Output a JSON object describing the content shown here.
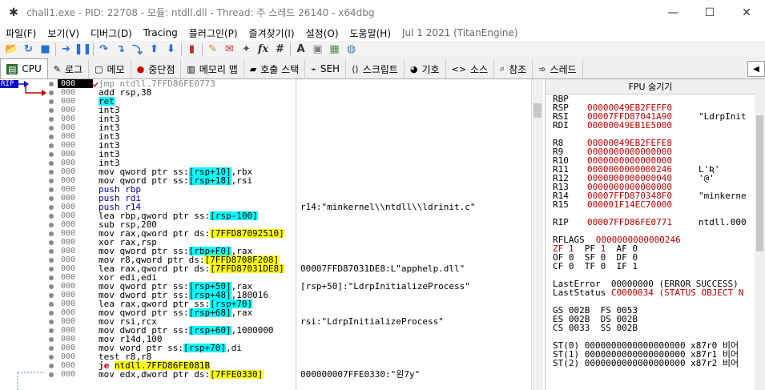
{
  "window": {
    "title": "chall1.exe - PID: 22708 - 모듈: ntdll.dll - Thread: 주 스레드 26140 - x64dbg",
    "minimize": "—",
    "maximize": "☐",
    "close": "✕"
  },
  "menu": [
    "파일(F)",
    "보기(V)",
    "디버그(D)",
    "Tracing",
    "플러그인(P)",
    "즐겨찾기(I)",
    "설정(O)",
    "도움말(H)"
  ],
  "version": "Jul 1 2021 (TitanEngine)",
  "toolbar": [
    {
      "icon": "folder-open-icon",
      "glyph": "📂",
      "color": "#d89a28"
    },
    {
      "icon": "restart-icon",
      "glyph": "↻",
      "color": "#2a6fd6"
    },
    {
      "icon": "stop-icon",
      "glyph": "■",
      "color": "#2a6fd6"
    },
    {
      "icon": "run-icon",
      "glyph": "➜",
      "color": "#2a6fd6"
    },
    {
      "icon": "pause-icon",
      "glyph": "❚❚",
      "color": "#2a6fd6"
    },
    {
      "icon": "step-into-icon",
      "glyph": "↷",
      "color": "#2a6fd6"
    },
    {
      "icon": "step-over-icon",
      "glyph": "↴",
      "color": "#2a6fd6"
    },
    {
      "icon": "trace-into-icon",
      "glyph": "⤵",
      "color": "#2a6fd6"
    },
    {
      "icon": "run-to-user-icon",
      "glyph": "⬆",
      "color": "#2a6fd6"
    },
    {
      "icon": "execute-till-return-icon",
      "glyph": "⬇",
      "color": "#2a6fd6"
    },
    {
      "icon": "breakpoint-list-icon",
      "glyph": "▮",
      "color": "#c03030"
    },
    {
      "icon": "patch-icon",
      "glyph": "✎",
      "color": "#d08a40"
    },
    {
      "icon": "comment-icon",
      "glyph": "✉",
      "color": "#d03030"
    },
    {
      "icon": "label-icon",
      "glyph": "✦",
      "color": "#555555"
    },
    {
      "icon": "function-icon",
      "glyph": "fx",
      "color": "#333333"
    },
    {
      "icon": "hash-icon",
      "glyph": "#",
      "color": "#333333"
    },
    {
      "icon": "font-a-icon",
      "glyph": "A",
      "color": "#333333"
    },
    {
      "icon": "bookmark-icon",
      "glyph": "▣",
      "color": "#808080"
    },
    {
      "icon": "calculator-icon",
      "glyph": "▦",
      "color": "#4a8a4a"
    },
    {
      "icon": "globe-icon",
      "glyph": "◍",
      "color": "#3a7ab0"
    }
  ],
  "tabs": [
    {
      "label": "CPU",
      "icon": "cpu-icon",
      "glyph": "▤",
      "active": true
    },
    {
      "label": "로그",
      "icon": "log-icon",
      "glyph": "✎"
    },
    {
      "label": "메모",
      "icon": "notes-icon",
      "glyph": "▢"
    },
    {
      "label": "중단점",
      "icon": "breakpoint-icon",
      "glyph": "●"
    },
    {
      "label": "메모리 맵",
      "icon": "memory-map-icon",
      "glyph": "▥"
    },
    {
      "label": "호출 스택",
      "icon": "call-stack-icon",
      "glyph": "▰"
    },
    {
      "label": "SEH",
      "icon": "seh-icon",
      "glyph": "⌁"
    },
    {
      "label": "스크립트",
      "icon": "script-icon",
      "glyph": "⟨⟩"
    },
    {
      "label": "기호",
      "icon": "symbols-icon",
      "glyph": "◕"
    },
    {
      "label": "소스",
      "icon": "source-icon",
      "glyph": "<>"
    },
    {
      "label": "참조",
      "icon": "references-icon",
      "glyph": "⌕"
    },
    {
      "label": "스레드",
      "icon": "threads-icon",
      "glyph": "➾"
    }
  ],
  "rip_label": "RIP",
  "disasm_rows": [
    {
      "addr": "000",
      "parts": [
        {
          "t": "jmp ntdll.7FFD86FE0773"
        }
      ],
      "comment": "",
      "current": true
    },
    {
      "addr": "000",
      "parts": [
        {
          "t": "add rsp,38"
        }
      ],
      "comment": ""
    },
    {
      "addr": "000",
      "parts": [
        {
          "t": "ret",
          "c": "hl"
        }
      ],
      "comment": ""
    },
    {
      "addr": "000",
      "parts": [
        {
          "t": "int3"
        }
      ],
      "comment": ""
    },
    {
      "addr": "000",
      "parts": [
        {
          "t": "int3"
        }
      ],
      "comment": ""
    },
    {
      "addr": "000",
      "parts": [
        {
          "t": "int3"
        }
      ],
      "comment": ""
    },
    {
      "addr": "000",
      "parts": [
        {
          "t": "int3"
        }
      ],
      "comment": ""
    },
    {
      "addr": "000",
      "parts": [
        {
          "t": "int3"
        }
      ],
      "comment": ""
    },
    {
      "addr": "000",
      "parts": [
        {
          "t": "int3"
        }
      ],
      "comment": ""
    },
    {
      "addr": "000",
      "parts": [
        {
          "t": "int3"
        }
      ],
      "comment": ""
    },
    {
      "addr": "000",
      "parts": [
        {
          "t": "mov qword ptr ss:"
        },
        {
          "t": "[rsp+10]",
          "c": "hl"
        },
        {
          "t": ",rbx"
        }
      ],
      "comment": ""
    },
    {
      "addr": "000",
      "parts": [
        {
          "t": "mov qword ptr ss:"
        },
        {
          "t": "[rsp+18]",
          "c": "hl"
        },
        {
          "t": ",rsi"
        }
      ],
      "comment": ""
    },
    {
      "addr": "000",
      "parts": [
        {
          "t": "push rbp",
          "c": "kw-push"
        }
      ],
      "comment": ""
    },
    {
      "addr": "000",
      "parts": [
        {
          "t": "push rdi",
          "c": "kw-push"
        }
      ],
      "comment": ""
    },
    {
      "addr": "000",
      "parts": [
        {
          "t": "push r14",
          "c": "kw-push"
        }
      ],
      "comment": "r14:\"minkernel\\\\ntdll\\\\ldrinit.c\""
    },
    {
      "addr": "000",
      "parts": [
        {
          "t": "lea rbp,qword ptr ss:"
        },
        {
          "t": "[rsp-100]",
          "c": "hl"
        }
      ],
      "comment": ""
    },
    {
      "addr": "000",
      "parts": [
        {
          "t": "sub rsp,200"
        }
      ],
      "comment": ""
    },
    {
      "addr": "000",
      "parts": [
        {
          "t": "mov rax,qword ptr ds:"
        },
        {
          "t": "[7FFD87092510]",
          "c": "yl"
        }
      ],
      "comment": ""
    },
    {
      "addr": "000",
      "parts": [
        {
          "t": "xor rax,rsp"
        }
      ],
      "comment": ""
    },
    {
      "addr": "000",
      "parts": [
        {
          "t": "mov qword ptr ss:"
        },
        {
          "t": "[rbp+F0]",
          "c": "hl"
        },
        {
          "t": ",rax"
        }
      ],
      "comment": ""
    },
    {
      "addr": "000",
      "parts": [
        {
          "t": "mov r8,qword ptr ds:"
        },
        {
          "t": "[7FFD8708F208]",
          "c": "yl"
        }
      ],
      "comment": ""
    },
    {
      "addr": "000",
      "parts": [
        {
          "t": "lea rax,qword ptr ds:"
        },
        {
          "t": "[7FFD87031DE8]",
          "c": "yl"
        }
      ],
      "comment": "00007FFD87031DE8:L\"apphelp.dll\""
    },
    {
      "addr": "000",
      "parts": [
        {
          "t": "xor edi,edi"
        }
      ],
      "comment": ""
    },
    {
      "addr": "000",
      "parts": [
        {
          "t": "mov qword ptr ss:"
        },
        {
          "t": "[rsp+50]",
          "c": "hl"
        },
        {
          "t": ",rax"
        }
      ],
      "comment": "[rsp+50]:\"LdrpInitializeProcess\""
    },
    {
      "addr": "000",
      "parts": [
        {
          "t": "mov dword ptr ss:"
        },
        {
          "t": "[rsp+48]",
          "c": "hl"
        },
        {
          "t": ",180016"
        }
      ],
      "comment": ""
    },
    {
      "addr": "000",
      "parts": [
        {
          "t": "lea rax,qword ptr ss:"
        },
        {
          "t": "[rsp+70]",
          "c": "hl"
        }
      ],
      "comment": ""
    },
    {
      "addr": "000",
      "parts": [
        {
          "t": "mov qword ptr ss:"
        },
        {
          "t": "[rsp+68]",
          "c": "hl"
        },
        {
          "t": ",rax"
        }
      ],
      "comment": ""
    },
    {
      "addr": "000",
      "parts": [
        {
          "t": "mov rsi,rcx"
        }
      ],
      "comment": "rsi:\"LdrpInitializeProcess\""
    },
    {
      "addr": "000",
      "parts": [
        {
          "t": "mov dword ptr ss:"
        },
        {
          "t": "[rsp+60]",
          "c": "hl"
        },
        {
          "t": ",1000000"
        }
      ],
      "comment": ""
    },
    {
      "addr": "000",
      "parts": [
        {
          "t": "mov r14d,100"
        }
      ],
      "comment": ""
    },
    {
      "addr": "000",
      "parts": [
        {
          "t": "mov word ptr ss:"
        },
        {
          "t": "[rsp+70]",
          "c": "hl"
        },
        {
          "t": ",di"
        }
      ],
      "comment": ""
    },
    {
      "addr": "000",
      "parts": [
        {
          "t": "test r8,r8"
        }
      ],
      "comment": ""
    },
    {
      "addr": "000",
      "parts": [
        {
          "t": "je ",
          "c": "jmpred"
        },
        {
          "t": "ntdll.7FFD86FE081B",
          "c": "yl"
        }
      ],
      "comment": ""
    },
    {
      "addr": "000",
      "parts": [
        {
          "t": "mov edx,dword ptr ds:"
        },
        {
          "t": "[7FFE0330]",
          "c": "yl"
        }
      ],
      "comment": "000000007FFE0330:\"왼7y\""
    }
  ],
  "fpu_toggle": "FPU 숨기기",
  "registers": [
    {
      "n": "RBP",
      "v": "",
      "c": ""
    },
    {
      "n": "RSP",
      "v": "00000049EB2FEFF0",
      "c": ""
    },
    {
      "n": "RSI",
      "v": "00007FFD87041A90",
      "c": "\"LdrpInit"
    },
    {
      "n": "RDI",
      "v": "00000049EB1E5000",
      "c": ""
    },
    {
      "n": "",
      "v": "",
      "c": ""
    },
    {
      "n": "R8",
      "v": "00000049EB2FEFE8",
      "c": ""
    },
    {
      "n": "R9",
      "v": "0000000000000000",
      "c": ""
    },
    {
      "n": "R10",
      "v": "0000000000000000",
      "c": ""
    },
    {
      "n": "R11",
      "v": "0000000000000246",
      "c": "L'Ʀ'"
    },
    {
      "n": "R12",
      "v": "0000000000000040",
      "c": "'@'"
    },
    {
      "n": "R13",
      "v": "0000000000000000",
      "c": ""
    },
    {
      "n": "R14",
      "v": "00007FFD870348F0",
      "c": "\"minkerne"
    },
    {
      "n": "R15",
      "v": "000001F14EC70000",
      "c": ""
    },
    {
      "n": "",
      "v": "",
      "c": ""
    },
    {
      "n": "RIP",
      "v": "00007FFD86FE0771",
      "c": "ntdll.000"
    },
    {
      "n": "",
      "v": "",
      "c": ""
    },
    {
      "n": "RFLAGS",
      "v": "0000000000000246",
      "c": "",
      "raw": true
    },
    {
      "raw_line": [
        {
          "t": "ZF ",
          "c": "red"
        },
        {
          "t": "1",
          "c": "red"
        },
        {
          "t": "  PF "
        },
        {
          "t": "1",
          "c": "red"
        },
        {
          "t": "  AF 0"
        }
      ]
    },
    {
      "raw_line": [
        {
          "t": "OF 0  SF 0  DF 0"
        }
      ]
    },
    {
      "raw_line": [
        {
          "t": "CF 0  TF 0  IF 1"
        }
      ]
    },
    {
      "n": "",
      "v": "",
      "c": ""
    },
    {
      "raw_line": [
        {
          "t": "LastError  00000000 (ERROR_SUCCESS)"
        }
      ]
    },
    {
      "raw_line": [
        {
          "t": "LastStatus "
        },
        {
          "t": "C0000034 (STATUS_OBJECT_N",
          "c": "red"
        }
      ]
    },
    {
      "n": "",
      "v": "",
      "c": ""
    },
    {
      "raw_line": [
        {
          "t": "GS 002B  FS 0053"
        }
      ]
    },
    {
      "raw_line": [
        {
          "t": "ES 002B  DS 002B"
        }
      ]
    },
    {
      "raw_line": [
        {
          "t": "CS 0033  SS 002B"
        }
      ]
    },
    {
      "n": "",
      "v": "",
      "c": ""
    },
    {
      "raw_line": [
        {
          "t": "ST(0) 0000000000000000000 x87r0 비어"
        }
      ]
    },
    {
      "raw_line": [
        {
          "t": "ST(1) 0000000000000000000 x87r1 비어"
        }
      ]
    },
    {
      "raw_line": [
        {
          "t": "ST(2) 0000000000000000000 x87r2 비어"
        }
      ]
    }
  ]
}
